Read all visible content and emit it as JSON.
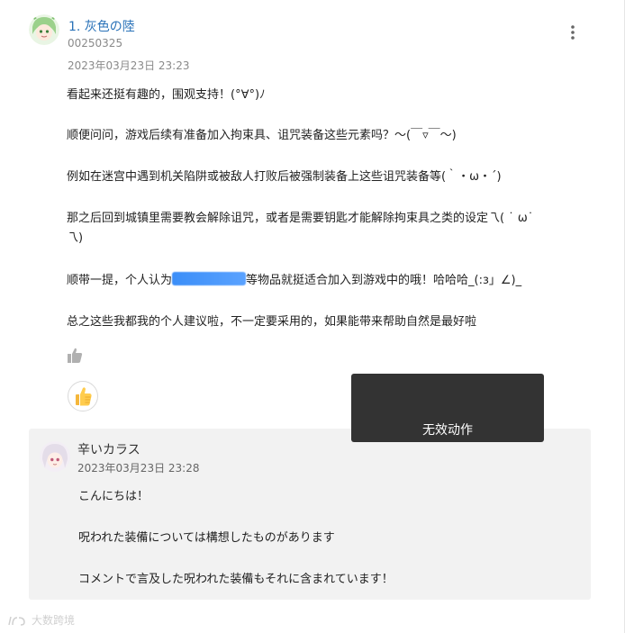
{
  "comment": {
    "title": "1. 灰色の陸",
    "user_id": "00250325",
    "timestamp": "2023年03月23日 23:23",
    "paragraphs": {
      "p1": "看起来还挺有趣的，围观支持！(°∀°)ﾉ",
      "p2": "顺便问问，游戏后续有准备加入拘束具、诅咒装备这些元素吗？～(￣▿￣～)",
      "p3": "例如在迷宫中遇到机关陷阱或被敌人打败后被强制装备上这些诅咒装备等(｀・ω・´)",
      "p4_line1": "那之后回到城镇里需要教会解除诅咒，或者是需要钥匙才能解除拘束具之类的设定乁( ˙ ω˙",
      "p4_line2": "乁)",
      "p5_before": "顺带一提，个人认为",
      "p5_after": "等物品就挺适合加入到游戏中的哦！哈哈哈_(:з」∠)_",
      "p6": "总之这些我都我的个人建议啦，不一定要采用的，如果能带来帮助自然是最好啦"
    }
  },
  "toast": {
    "text": "无效动作"
  },
  "reply": {
    "name": "辛いカラス",
    "timestamp": "2023年03月23日 23:28",
    "line1": "こんにちは！",
    "line2": "呪われた装備については構想したものがあります",
    "line3": "コメントで言及した呪われた装備もそれに含まれています！"
  },
  "watermark": {
    "text": "大数跨境"
  },
  "icons": {
    "menu": "more-vertical-icon",
    "like_small": "thumbs-up-icon",
    "like_big": "thumbs-up-emoji-icon"
  },
  "colors": {
    "link": "#2a72b8",
    "toast_bg": "#333333",
    "reply_bg": "#f2f2f2"
  }
}
